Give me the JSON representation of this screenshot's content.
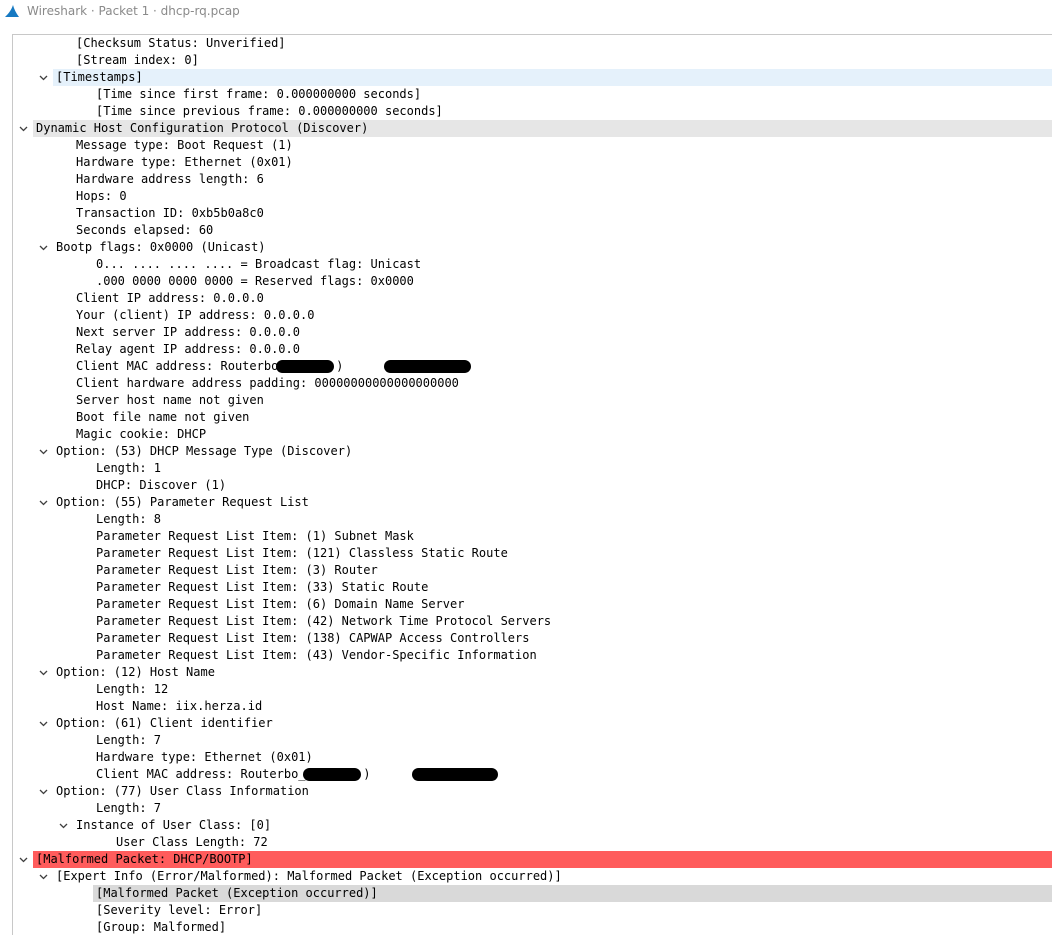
{
  "window": {
    "title": "Wireshark · Packet 1 · dhcp-rq.pcap"
  },
  "tree": {
    "rows": [
      {
        "text": "[Checksum Status: Unverified]",
        "depth": 2,
        "toggle": "none"
      },
      {
        "text": "[Stream index: 0]",
        "depth": 2,
        "toggle": "none"
      },
      {
        "text": "[Timestamps]",
        "depth": 1,
        "toggle": "expanded",
        "highlight": "sel-light"
      },
      {
        "text": "[Time since first frame: 0.000000000 seconds]",
        "depth": 3,
        "toggle": "none"
      },
      {
        "text": "[Time since previous frame: 0.000000000 seconds]",
        "depth": 3,
        "toggle": "none"
      },
      {
        "text": "Dynamic Host Configuration Protocol (Discover)",
        "depth": 0,
        "toggle": "expanded",
        "highlight": "sel-grey"
      },
      {
        "text": "Message type: Boot Request (1)",
        "depth": 2,
        "toggle": "none"
      },
      {
        "text": "Hardware type: Ethernet (0x01)",
        "depth": 2,
        "toggle": "none"
      },
      {
        "text": "Hardware address length: 6",
        "depth": 2,
        "toggle": "none"
      },
      {
        "text": "Hops: 0",
        "depth": 2,
        "toggle": "none"
      },
      {
        "text": "Transaction ID: 0xb5b0a8c0",
        "depth": 2,
        "toggle": "none"
      },
      {
        "text": "Seconds elapsed: 60",
        "depth": 2,
        "toggle": "none"
      },
      {
        "text": "Bootp flags: 0x0000 (Unicast)",
        "depth": 1,
        "toggle": "expanded"
      },
      {
        "text": "0... .... .... .... = Broadcast flag: Unicast",
        "depth": 3,
        "toggle": "none"
      },
      {
        "text": ".000 0000 0000 0000 = Reserved flags: 0x0000",
        "depth": 3,
        "toggle": "none"
      },
      {
        "text": "Client IP address: 0.0.0.0",
        "depth": 2,
        "toggle": "none"
      },
      {
        "text": "Your (client) IP address: 0.0.0.0",
        "depth": 2,
        "toggle": "none"
      },
      {
        "text": "Next server IP address: 0.0.0.0",
        "depth": 2,
        "toggle": "none"
      },
      {
        "text": "Relay agent IP address: 0.0.0.0",
        "depth": 2,
        "toggle": "none"
      },
      {
        "text": "Client MAC address: Routerbo         (64:d1            )",
        "depth": 2,
        "toggle": "none",
        "redacted": true
      },
      {
        "text": "Client hardware address padding: 00000000000000000000",
        "depth": 2,
        "toggle": "none"
      },
      {
        "text": "Server host name not given",
        "depth": 2,
        "toggle": "none"
      },
      {
        "text": "Boot file name not given",
        "depth": 2,
        "toggle": "none"
      },
      {
        "text": "Magic cookie: DHCP",
        "depth": 2,
        "toggle": "none"
      },
      {
        "text": "Option: (53) DHCP Message Type (Discover)",
        "depth": 1,
        "toggle": "expanded"
      },
      {
        "text": "Length: 1",
        "depth": 3,
        "toggle": "none"
      },
      {
        "text": "DHCP: Discover (1)",
        "depth": 3,
        "toggle": "none"
      },
      {
        "text": "Option: (55) Parameter Request List",
        "depth": 1,
        "toggle": "expanded"
      },
      {
        "text": "Length: 8",
        "depth": 3,
        "toggle": "none"
      },
      {
        "text": "Parameter Request List Item: (1) Subnet Mask",
        "depth": 3,
        "toggle": "none"
      },
      {
        "text": "Parameter Request List Item: (121) Classless Static Route",
        "depth": 3,
        "toggle": "none"
      },
      {
        "text": "Parameter Request List Item: (3) Router",
        "depth": 3,
        "toggle": "none"
      },
      {
        "text": "Parameter Request List Item: (33) Static Route",
        "depth": 3,
        "toggle": "none"
      },
      {
        "text": "Parameter Request List Item: (6) Domain Name Server",
        "depth": 3,
        "toggle": "none"
      },
      {
        "text": "Parameter Request List Item: (42) Network Time Protocol Servers",
        "depth": 3,
        "toggle": "none"
      },
      {
        "text": "Parameter Request List Item: (138) CAPWAP Access Controllers",
        "depth": 3,
        "toggle": "none"
      },
      {
        "text": "Parameter Request List Item: (43) Vendor-Specific Information",
        "depth": 3,
        "toggle": "none"
      },
      {
        "text": "Option: (12) Host Name",
        "depth": 1,
        "toggle": "expanded"
      },
      {
        "text": "Length: 12",
        "depth": 3,
        "toggle": "none"
      },
      {
        "text": "Host Name: iix.herza.id",
        "depth": 3,
        "toggle": "none"
      },
      {
        "text": "Option: (61) Client identifier",
        "depth": 1,
        "toggle": "expanded"
      },
      {
        "text": "Length: 7",
        "depth": 3,
        "toggle": "none"
      },
      {
        "text": "Hardware type: Ethernet (0x01)",
        "depth": 3,
        "toggle": "none"
      },
      {
        "text": "Client MAC address: Routerbo_         (64:d1            )",
        "depth": 3,
        "toggle": "none",
        "redacted": true
      },
      {
        "text": "Option: (77) User Class Information",
        "depth": 1,
        "toggle": "expanded"
      },
      {
        "text": "Length: 7",
        "depth": 3,
        "toggle": "none"
      },
      {
        "text": "Instance of User Class: [0]",
        "depth": 2,
        "toggle": "expanded"
      },
      {
        "text": "User Class Length: 72",
        "depth": 4,
        "toggle": "none"
      },
      {
        "text": "[Malformed Packet: DHCP/BOOTP]",
        "depth": 0,
        "toggle": "expanded",
        "highlight": "err"
      },
      {
        "text": "[Expert Info (Error/Malformed): Malformed Packet (Exception occurred)]",
        "depth": 1,
        "toggle": "expanded"
      },
      {
        "text": "[Malformed Packet (Exception occurred)]",
        "depth": 3,
        "toggle": "none",
        "highlight": "sel-dark"
      },
      {
        "text": "[Severity level: Error]",
        "depth": 3,
        "toggle": "none"
      },
      {
        "text": "[Group: Malformed]",
        "depth": 3,
        "toggle": "none"
      }
    ]
  }
}
